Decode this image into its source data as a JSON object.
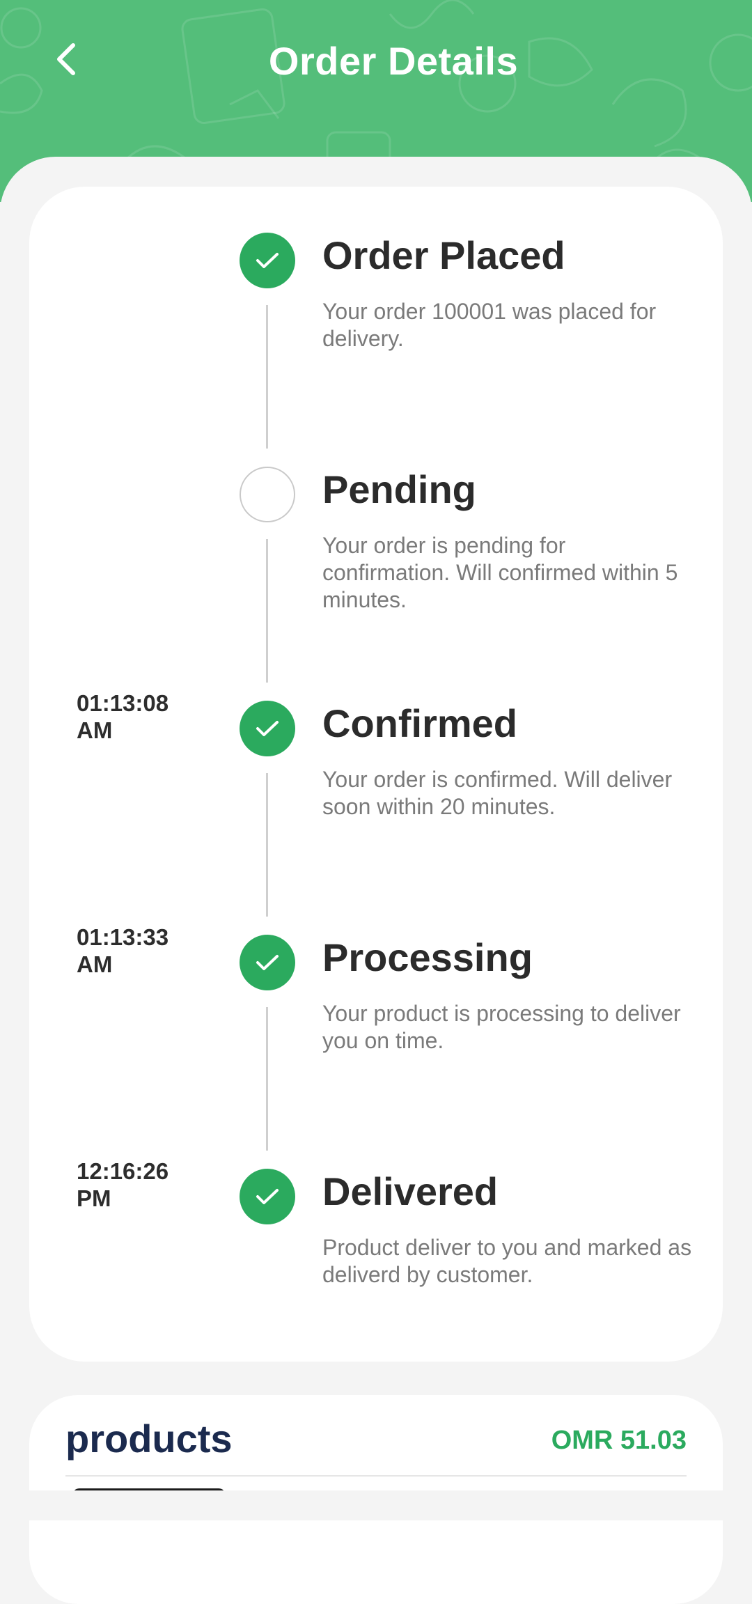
{
  "header": {
    "title": "Order Details",
    "back_icon": "chevron-left-icon",
    "background_color": "#54be7a"
  },
  "timeline": [
    {
      "time": "",
      "status": "done",
      "title": "Order Placed",
      "description": "Your order 100001 was placed for delivery."
    },
    {
      "time": "",
      "status": "pending",
      "title": "Pending",
      "description": "Your order is pending for confirmation. Will confirmed within 5 minutes."
    },
    {
      "time": "01:13:08 AM",
      "status": "done",
      "title": "Confirmed",
      "description": "Your order is confirmed. Will deliver soon within 20 minutes."
    },
    {
      "time": "01:13:33 AM",
      "status": "done",
      "title": "Processing",
      "description": "Your product is processing to deliver you on time."
    },
    {
      "time": "12:16:26 PM",
      "status": "done",
      "title": "Delivered",
      "description": "Product deliver to you and marked as deliverd by customer."
    }
  ],
  "products": {
    "title": "products",
    "total": "OMR 51.03"
  },
  "colors": {
    "accent_green": "#2baa5e",
    "title_dark": "#1b2a4e"
  }
}
